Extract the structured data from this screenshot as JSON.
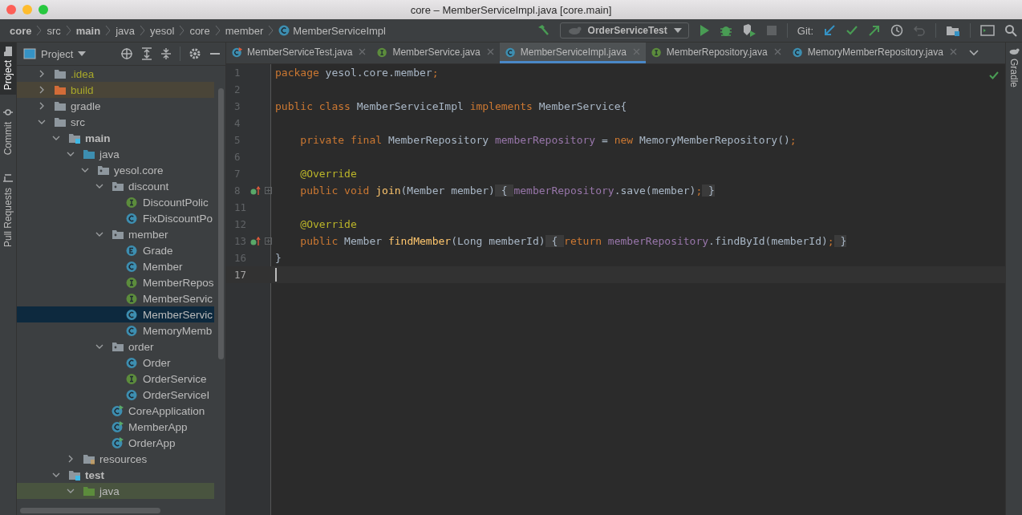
{
  "window": {
    "title": "core – MemberServiceImpl.java [core.main]"
  },
  "breadcrumbs": [
    {
      "label": "core",
      "bold": true,
      "kind": "plain"
    },
    {
      "label": "src",
      "bold": false,
      "kind": "plain"
    },
    {
      "label": "main",
      "bold": true,
      "kind": "plain"
    },
    {
      "label": "java",
      "bold": false,
      "kind": "plain"
    },
    {
      "label": "yesol",
      "bold": false,
      "kind": "plain"
    },
    {
      "label": "core",
      "bold": false,
      "kind": "plain"
    },
    {
      "label": "member",
      "bold": false,
      "kind": "plain"
    },
    {
      "label": "MemberServiceImpl",
      "bold": false,
      "kind": "class"
    }
  ],
  "toolbar": {
    "run_config": "OrderServiceTest",
    "git_label": "Git:"
  },
  "tool_strip": [
    {
      "label": "Project",
      "selected": true,
      "kind": "folder"
    },
    {
      "label": "Commit",
      "selected": false,
      "kind": "commit"
    },
    {
      "label": "Pull Requests",
      "selected": false,
      "kind": "pull"
    }
  ],
  "right_strip": [
    {
      "label": "Gradle"
    }
  ],
  "project_panel": {
    "title": "Project"
  },
  "tree": [
    {
      "label": ".idea",
      "kind": "folder",
      "expanded": false,
      "ignored": true,
      "selected": false
    },
    {
      "label": "build",
      "kind": "folder-excluded",
      "expanded": false,
      "ignored": true,
      "selected": false
    },
    {
      "label": "gradle",
      "kind": "folder",
      "expanded": false,
      "ignored": false,
      "selected": false
    },
    {
      "label": "src",
      "kind": "folder",
      "expanded": true,
      "ignored": false,
      "selected": false,
      "children": [
        {
          "label": "main",
          "kind": "source-root",
          "expanded": true,
          "ignored": false,
          "selected": false,
          "children": [
            {
              "label": "java",
              "kind": "source-folder",
              "expanded": true,
              "ignored": false,
              "selected": false,
              "children": [
                {
                  "label": "yesol.core",
                  "kind": "package",
                  "expanded": true,
                  "ignored": false,
                  "selected": false,
                  "children": [
                    {
                      "label": "discount",
                      "kind": "package",
                      "expanded": true,
                      "ignored": false,
                      "selected": false,
                      "children": [
                        {
                          "label": "DiscountPolic",
                          "kind": "interface",
                          "ignored": false,
                          "selected": false
                        },
                        {
                          "label": "FixDiscountPo",
                          "kind": "class",
                          "ignored": false,
                          "selected": false
                        }
                      ]
                    },
                    {
                      "label": "member",
                      "kind": "package",
                      "expanded": true,
                      "ignored": false,
                      "selected": false,
                      "children": [
                        {
                          "label": "Grade",
                          "kind": "enum",
                          "ignored": false,
                          "selected": false
                        },
                        {
                          "label": "Member",
                          "kind": "class",
                          "ignored": false,
                          "selected": false
                        },
                        {
                          "label": "MemberRepos",
                          "kind": "interface",
                          "ignored": false,
                          "selected": false
                        },
                        {
                          "label": "MemberServic",
                          "kind": "interface",
                          "ignored": false,
                          "selected": false
                        },
                        {
                          "label": "MemberServic",
                          "kind": "class",
                          "ignored": false,
                          "selected": true
                        },
                        {
                          "label": "MemoryMemb",
                          "kind": "class",
                          "ignored": false,
                          "selected": false
                        }
                      ]
                    },
                    {
                      "label": "order",
                      "kind": "package",
                      "expanded": true,
                      "ignored": false,
                      "selected": false,
                      "children": [
                        {
                          "label": "Order",
                          "kind": "class",
                          "ignored": false,
                          "selected": false
                        },
                        {
                          "label": "OrderService",
                          "kind": "interface",
                          "ignored": false,
                          "selected": false
                        },
                        {
                          "label": "OrderServiceI",
                          "kind": "class",
                          "ignored": false,
                          "selected": false
                        }
                      ]
                    },
                    {
                      "label": "CoreApplication",
                      "kind": "app",
                      "ignored": false,
                      "selected": false
                    },
                    {
                      "label": "MemberApp",
                      "kind": "app",
                      "ignored": false,
                      "selected": false
                    },
                    {
                      "label": "OrderApp",
                      "kind": "app",
                      "ignored": false,
                      "selected": false
                    }
                  ]
                }
              ]
            },
            {
              "label": "resources",
              "kind": "resources",
              "expanded": false,
              "ignored": false,
              "selected": false
            }
          ]
        },
        {
          "label": "test",
          "kind": "source-root",
          "expanded": true,
          "ignored": false,
          "selected": false,
          "children": [
            {
              "label": "java",
              "kind": "test-folder",
              "expanded": true,
              "ignored": false,
              "selected": false
            }
          ]
        }
      ]
    }
  ],
  "tabs": [
    {
      "label": "MemberServiceTest.java",
      "kind": "test",
      "selected": false
    },
    {
      "label": "MemberService.java",
      "kind": "interface",
      "selected": false
    },
    {
      "label": "MemberServiceImpl.java",
      "kind": "class",
      "selected": true
    },
    {
      "label": "MemberRepository.java",
      "kind": "interface",
      "selected": false
    },
    {
      "label": "MemoryMemberRepository.java",
      "kind": "class",
      "selected": false
    }
  ],
  "code": [
    {
      "number": "1",
      "current": false,
      "override_marker": false,
      "tokens": [
        {
          "text": "package",
          "kind": "kw"
        },
        {
          "text": " yesol.core.member",
          "kind": "plain"
        },
        {
          "text": ";",
          "kind": "kw"
        }
      ]
    },
    {
      "number": "2",
      "current": false,
      "override_marker": false
    },
    {
      "number": "3",
      "current": false,
      "override_marker": false,
      "tokens": [
        {
          "text": "public class",
          "kind": "kw"
        },
        {
          "text": " MemberServiceImpl ",
          "kind": "plain"
        },
        {
          "text": "implements",
          "kind": "kw"
        },
        {
          "text": " MemberService{",
          "kind": "plain"
        }
      ]
    },
    {
      "number": "4",
      "current": false,
      "override_marker": false
    },
    {
      "number": "5",
      "current": false,
      "override_marker": false,
      "tokens": [
        {
          "text": "    private final",
          "kind": "kw"
        },
        {
          "text": " MemberRepository ",
          "kind": "plain"
        },
        {
          "text": "memberRepository",
          "kind": "field"
        },
        {
          "text": " = ",
          "kind": "plain"
        },
        {
          "text": "new",
          "kind": "kw"
        },
        {
          "text": " MemoryMemberRepository()",
          "kind": "plain"
        },
        {
          "text": ";",
          "kind": "kw"
        }
      ]
    },
    {
      "number": "6",
      "current": false,
      "override_marker": false
    },
    {
      "number": "7",
      "current": false,
      "override_marker": false,
      "tokens": [
        {
          "text": "    @Override",
          "kind": "ann"
        }
      ]
    },
    {
      "number": "8",
      "current": false,
      "override_marker": true,
      "tokens": [
        {
          "text": "    public void",
          "kind": "kw"
        },
        {
          "text": " join",
          "kind": "fn"
        },
        {
          "text": "(Member member)",
          "kind": "plain"
        },
        {
          "text": " { ",
          "kind": "fold"
        },
        {
          "text": "memberRepository",
          "kind": "field"
        },
        {
          "text": ".save(member)",
          "kind": "plain"
        },
        {
          "text": ";",
          "kind": "kw"
        },
        {
          "text": " }",
          "kind": "fold"
        }
      ]
    },
    {
      "number": "11",
      "current": false,
      "override_marker": false
    },
    {
      "number": "12",
      "current": false,
      "override_marker": false,
      "tokens": [
        {
          "text": "    @Override",
          "kind": "ann"
        }
      ]
    },
    {
      "number": "13",
      "current": false,
      "override_marker": true,
      "tokens": [
        {
          "text": "    public",
          "kind": "kw"
        },
        {
          "text": " Member ",
          "kind": "plain"
        },
        {
          "text": "findMember",
          "kind": "fn"
        },
        {
          "text": "(Long memberId)",
          "kind": "plain"
        },
        {
          "text": " { ",
          "kind": "fold"
        },
        {
          "text": "return",
          "kind": "kw"
        },
        {
          "text": " memberRepository",
          "kind": "field"
        },
        {
          "text": ".findById(memberId)",
          "kind": "plain"
        },
        {
          "text": ";",
          "kind": "kw"
        },
        {
          "text": " }",
          "kind": "fold"
        }
      ]
    },
    {
      "number": "16",
      "current": false,
      "override_marker": false,
      "tokens": [
        {
          "text": "}",
          "kind": "plain"
        }
      ]
    },
    {
      "number": "17",
      "current": true,
      "override_marker": false
    }
  ]
}
